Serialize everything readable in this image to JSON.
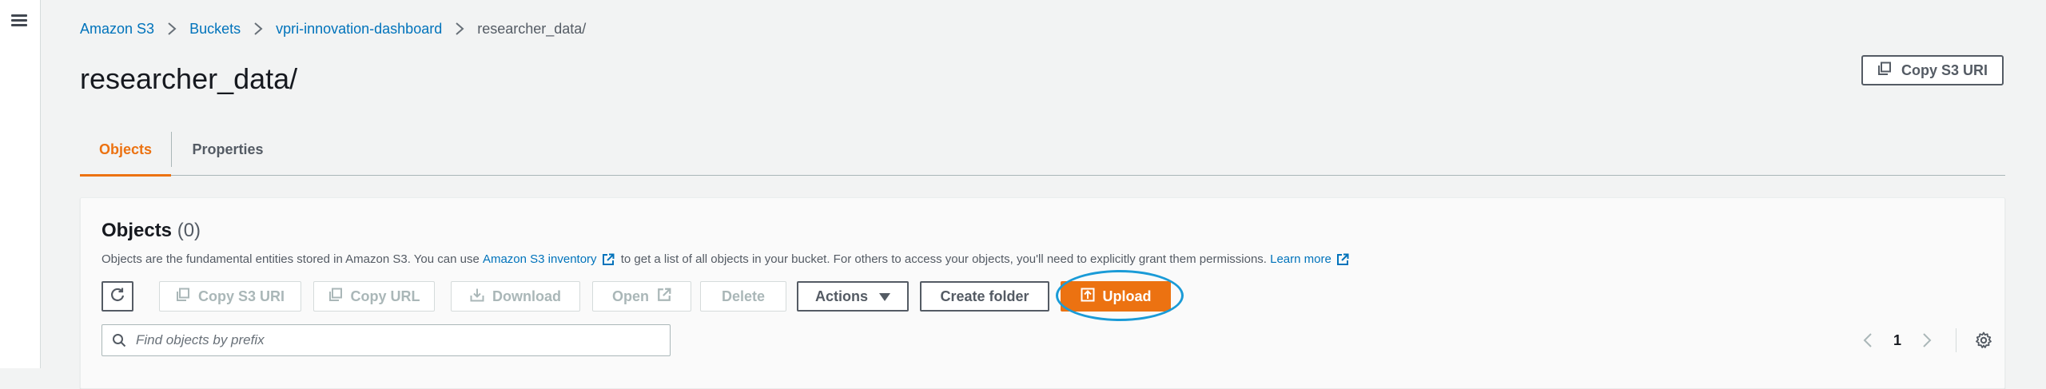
{
  "breadcrumb": {
    "items": [
      "Amazon S3",
      "Buckets",
      "vpri-innovation-dashboard"
    ],
    "current": "researcher_data/"
  },
  "page": {
    "title": "researcher_data/",
    "copy_uri_label": "Copy S3 URI"
  },
  "tabs": {
    "objects": "Objects",
    "properties": "Properties",
    "active": "Objects"
  },
  "panel": {
    "title": "Objects",
    "count": "(0)",
    "desc_part1": "Objects are the fundamental entities stored in Amazon S3. You can use ",
    "inventory_link": "Amazon S3 inventory",
    "desc_part2": " to get a list of all objects in your bucket. For others to access your objects, you'll need to explicitly grant them permissions. ",
    "learn_more": "Learn more"
  },
  "toolbar": {
    "copy_s3_uri": "Copy S3 URI",
    "copy_url": "Copy URL",
    "download": "Download",
    "open": "Open",
    "delete": "Delete",
    "actions": "Actions",
    "create_folder": "Create folder",
    "upload": "Upload"
  },
  "search": {
    "placeholder": "Find objects by prefix",
    "value": ""
  },
  "pagination": {
    "current_page": "1"
  },
  "colors": {
    "accent": "#ec7211",
    "link": "#0073bb",
    "highlight_ring": "#1a9bd7"
  }
}
